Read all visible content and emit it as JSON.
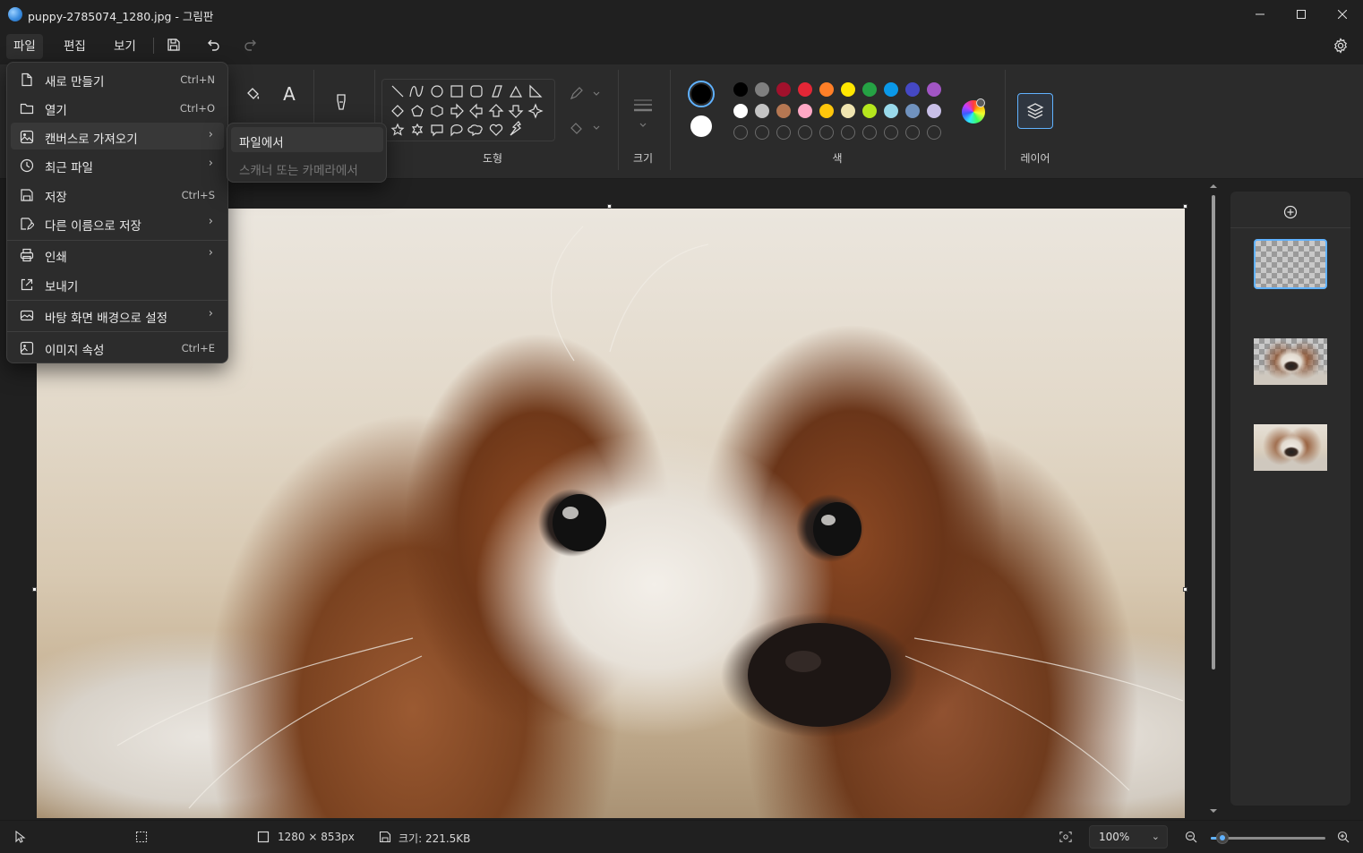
{
  "window": {
    "title": "puppy-2785074_1280.jpg - 그림판",
    "controls": {
      "minimize": "─",
      "maximize": "☐",
      "close": "✕"
    }
  },
  "menubar": {
    "items": [
      {
        "label": "파일",
        "active": true
      },
      {
        "label": "편집",
        "active": false
      },
      {
        "label": "보기",
        "active": false
      }
    ],
    "quick_access": [
      "save-icon",
      "undo-icon",
      "redo-icon"
    ],
    "settings_icon": "gear-icon"
  },
  "ribbon": {
    "groups": {
      "shapes_label": "도형",
      "size_label": "크기",
      "colors_label": "색",
      "layers_label": "레이어"
    },
    "text_tool_glyph": "A",
    "primary_color": "#000000",
    "secondary_color": "#ffffff",
    "palette_row1": [
      "#000000",
      "#7f7f7f",
      "#a1112c",
      "#e32636",
      "#ff7f27",
      "#ffe600",
      "#25a244",
      "#0a98e8",
      "#4548c4",
      "#a155c4"
    ],
    "palette_row2": [
      "#ffffff",
      "#c3c3c3",
      "#b57752",
      "#ffa8c5",
      "#ffc60b",
      "#efe4b0",
      "#b5e61d",
      "#99d9ea",
      "#7092be",
      "#c8bfe7"
    ],
    "custom_color_slots": 10,
    "accent_color": "#60b2ff"
  },
  "file_menu": {
    "items": [
      {
        "icon": "new-file-icon",
        "label": "새로 만들기",
        "shortcut": "Ctrl+N",
        "submenu": false
      },
      {
        "icon": "folder-icon",
        "label": "열기",
        "shortcut": "Ctrl+O",
        "submenu": false
      },
      {
        "icon": "import-image-icon",
        "label": "캔버스로 가져오기",
        "shortcut": "",
        "submenu": true,
        "highlight": true
      },
      {
        "icon": "clock-icon",
        "label": "최근 파일",
        "shortcut": "",
        "submenu": true
      },
      {
        "icon": "save-icon",
        "label": "저장",
        "shortcut": "Ctrl+S",
        "submenu": false
      },
      {
        "icon": "save-as-icon",
        "label": "다른 이름으로 저장",
        "shortcut": "",
        "submenu": true
      },
      {
        "icon": "printer-icon",
        "label": "인쇄",
        "shortcut": "",
        "submenu": true
      },
      {
        "icon": "share-icon",
        "label": "보내기",
        "shortcut": "",
        "submenu": false
      },
      {
        "icon": "wallpaper-icon",
        "label": "바탕 화면 배경으로 설정",
        "shortcut": "",
        "submenu": true
      },
      {
        "icon": "image-properties-icon",
        "label": "이미지 속성",
        "shortcut": "Ctrl+E",
        "submenu": false
      }
    ]
  },
  "import_submenu": {
    "items": [
      {
        "label": "파일에서",
        "enabled": true
      },
      {
        "label": "스캐너 또는 카메라에서",
        "enabled": false
      }
    ]
  },
  "layers_panel": {
    "add_icon": "plus-circle-icon",
    "layers": [
      {
        "name": "transparent-layer",
        "selected": true
      },
      {
        "name": "puppy-layer-cutout",
        "selected": false
      },
      {
        "name": "puppy-layer-background",
        "selected": false
      }
    ]
  },
  "statusbar": {
    "dimensions": "1280 × 853px",
    "file_size": "크기: 221.5KB",
    "zoom": "100%",
    "zoom_fraction": 0.1
  }
}
